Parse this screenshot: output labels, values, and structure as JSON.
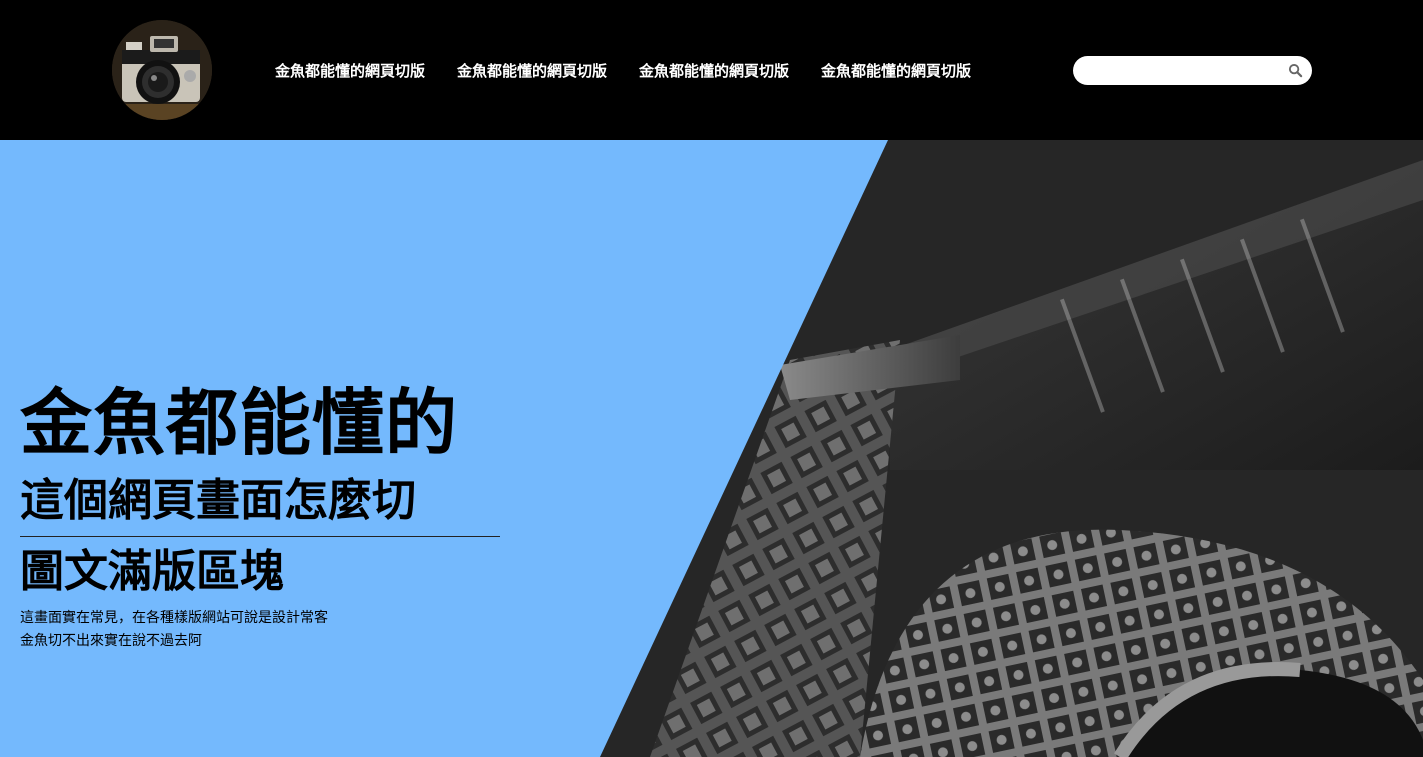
{
  "header": {
    "nav": [
      {
        "label": "金魚都能懂的網頁切版"
      },
      {
        "label": "金魚都能懂的網頁切版"
      },
      {
        "label": "金魚都能懂的網頁切版"
      },
      {
        "label": "金魚都能懂的網頁切版"
      }
    ],
    "search": {
      "value": "",
      "placeholder": "",
      "icon": "search-icon"
    },
    "logo": {
      "icon": "camera-logo"
    }
  },
  "hero": {
    "title": "金魚都能懂的",
    "subtitle": "這個網頁畫面怎麼切",
    "subtitle2": "圖文滿版區塊",
    "description_line1": "這畫面實在常見，在各種樣版網站可說是設計常客",
    "description_line2": "金魚切不出來實在說不過去阿",
    "colors": {
      "panel": "#74b9fd",
      "header_bg": "#000000",
      "photo_tone": "#2a2a2a"
    }
  }
}
